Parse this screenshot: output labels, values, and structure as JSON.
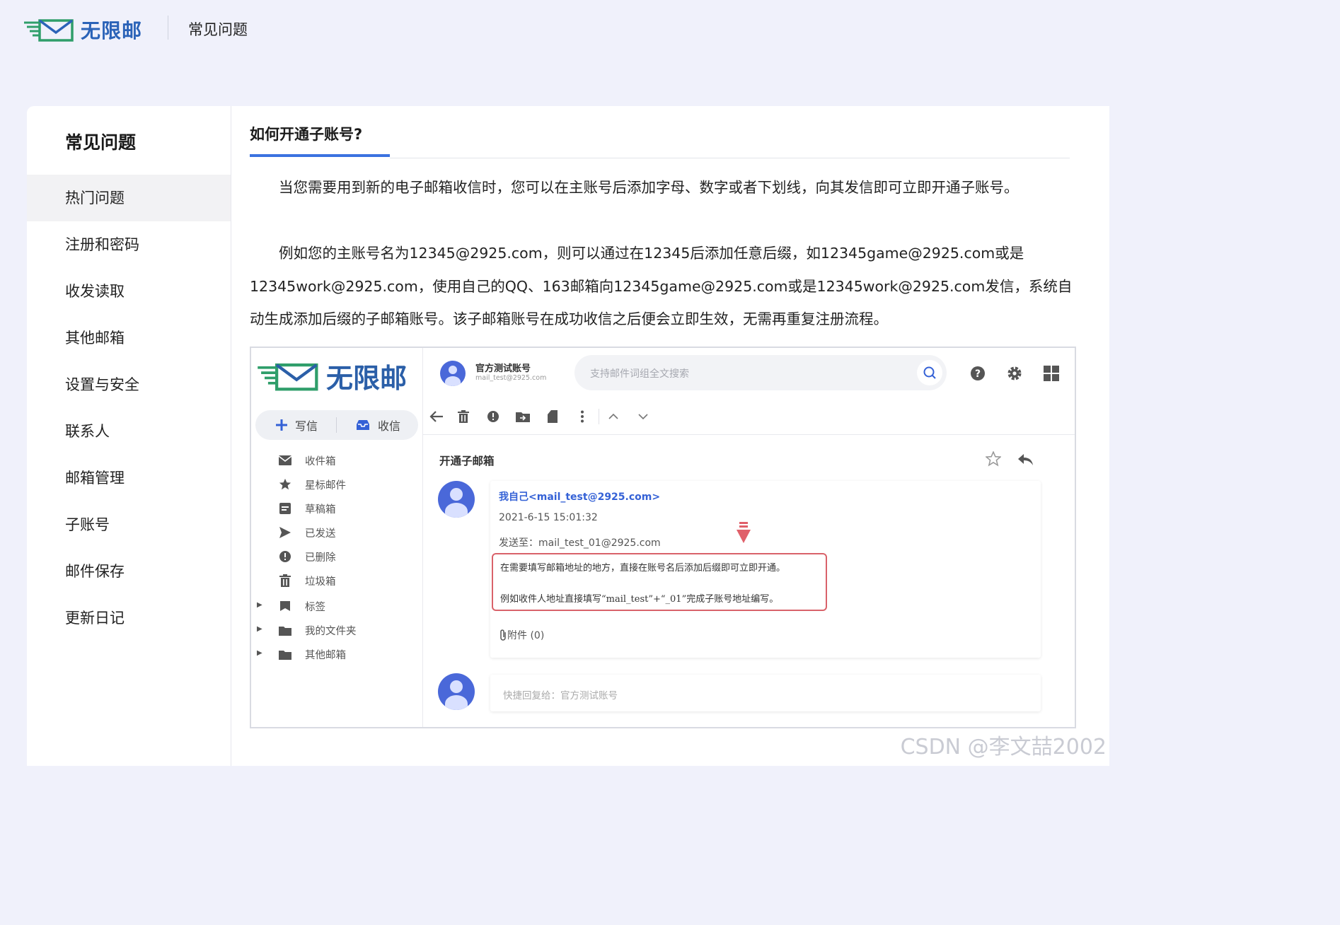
{
  "header": {
    "brand": "无限邮",
    "page_title": "常见问题"
  },
  "sidebar": {
    "title": "常见问题",
    "items": [
      {
        "label": "热门问题",
        "active": true
      },
      {
        "label": "注册和密码"
      },
      {
        "label": "收发读取"
      },
      {
        "label": "其他邮箱"
      },
      {
        "label": "设置与安全"
      },
      {
        "label": "联系人"
      },
      {
        "label": "邮箱管理"
      },
      {
        "label": "子账号"
      },
      {
        "label": "邮件保存"
      },
      {
        "label": "更新日记"
      }
    ]
  },
  "article": {
    "title": "如何开通子账号?",
    "paragraph1": "当您需要用到新的电子邮箱收信时，您可以在主账号后添加字母、数字或者下划线，向其发信即可立即开通子账号。",
    "paragraph2": "例如您的主账号名为12345@2925.com，则可以通过在12345后添加任意后缀，如12345game@2925.com或是12345work@2925.com，使用自己的QQ、163邮箱向12345game@2925.com或是12345work@2925.com发信，系统自动生成添加后缀的子邮箱账号。该子邮箱账号在成功收信之后便会立即生效，无需再重复注册流程。"
  },
  "screenshot": {
    "brand": "无限邮",
    "account_name": "官方测试账号",
    "account_email": "mail_test@2925.com",
    "search_placeholder": "支持邮件词组全文搜索",
    "compose_label": "写信",
    "receive_label": "收信",
    "folders": [
      {
        "label": "收件箱",
        "icon": "inbox-icon"
      },
      {
        "label": "星标邮件",
        "icon": "star-icon"
      },
      {
        "label": "草稿箱",
        "icon": "draft-icon"
      },
      {
        "label": "已发送",
        "icon": "send-icon"
      },
      {
        "label": "已删除",
        "icon": "deleted-icon"
      },
      {
        "label": "垃圾箱",
        "icon": "trash-icon"
      },
      {
        "label": "标签",
        "icon": "tag-icon",
        "expandable": true
      },
      {
        "label": "我的文件夹",
        "icon": "folder-icon",
        "expandable": true
      },
      {
        "label": "其他邮箱",
        "icon": "folder-icon",
        "expandable": true
      }
    ],
    "subject": "开通子邮箱",
    "sender": "我自己<mail_test@2925.com>",
    "sent_time": "2021-6-15 15:01:32",
    "to_line": "发送至：mail_test_01@2925.com",
    "highlight_line1": "在需要填写邮箱地址的地方，直接在账号名后添加后缀即可立即开通。",
    "highlight_line2": "例如收件人地址直接填写“mail_test”+“_01”完成子账号地址编写。",
    "attachments": "附件 (0)",
    "reply_placeholder": "快捷回复给：官方测试账号"
  },
  "watermark": "CSDN @李文喆2002",
  "colors": {
    "accent_blue": "#3b72e0",
    "brand_green": "#2f9e6a",
    "brand_blue": "#2b63b8",
    "highlight_red": "#d9626a",
    "avatar_blue": "#4a68d9"
  }
}
